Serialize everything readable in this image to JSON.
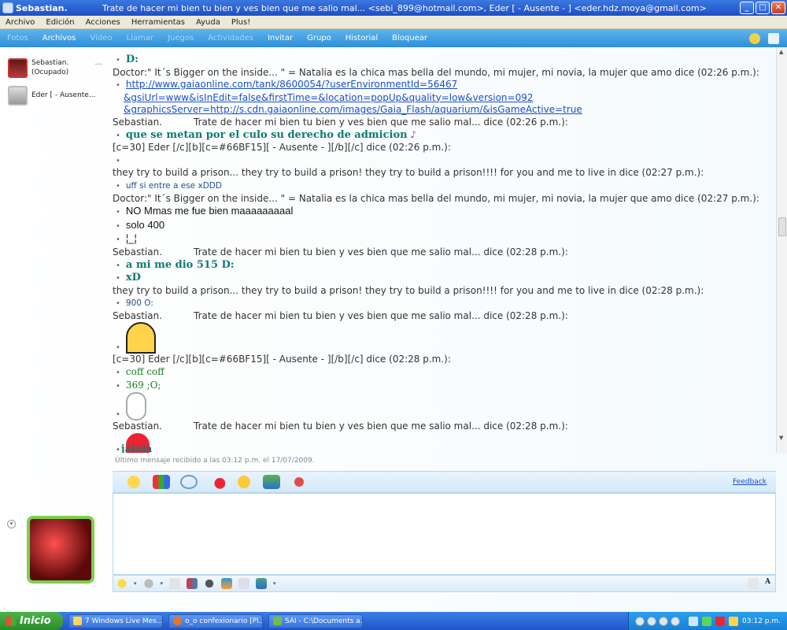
{
  "window": {
    "app_name": "Sebastian.",
    "title": "Trate de hacer mi bien tu bien y ves bien que me salio mal... <sebi_899@hotmail.com>,   Eder [ -  Ausente  -   ] <eder.hdz.moya@gmail.com>",
    "minimize": "_",
    "maximize": "□",
    "close": "✕"
  },
  "menu": [
    "Archivo",
    "Edición",
    "Acciones",
    "Herramientas",
    "Ayuda",
    "Plus!"
  ],
  "toolbar": {
    "items": [
      {
        "label": "Fotos",
        "enabled": false
      },
      {
        "label": "Archivos",
        "enabled": true
      },
      {
        "label": "Vídeo",
        "enabled": false
      },
      {
        "label": "Llamar",
        "enabled": false
      },
      {
        "label": "Juegos",
        "enabled": false
      },
      {
        "label": "Actividades",
        "enabled": false
      },
      {
        "label": "Invitar",
        "enabled": true
      },
      {
        "label": "Grupo",
        "enabled": true
      },
      {
        "label": "Historial",
        "enabled": true
      },
      {
        "label": "Bloquear",
        "enabled": true
      }
    ]
  },
  "contacts": [
    {
      "name": "Sebastian.",
      "status": "(Ocupado)",
      "more": "..."
    },
    {
      "name": "Eder [ -  Ausente...",
      "status": ""
    }
  ],
  "chat": {
    "lines": [
      {
        "type": "bullet",
        "style": "teal",
        "text": "D:"
      },
      {
        "type": "header",
        "text": "Doctor:\"  It´s Bigger on the inside... \" = Natalia es la chica mas bella del mundo, mi mujer, mi novia, la mujer que amo dice (02:26 p.m.):"
      },
      {
        "type": "bullet",
        "style": "link",
        "text": "http://www.gaiaonline.com/tank/8600054/?userEnvironmentId=56467"
      },
      {
        "type": "cont",
        "style": "link",
        "text": "&gsiUrl=www&isInEdit=false&firstTime=&location=popUp&quality=low&version=092"
      },
      {
        "type": "cont",
        "style": "link",
        "text": "&graphicsServer=http://s.cdn.gaiaonline.com/images/Gaia_Flash/aquarium/&isGameActive=true"
      },
      {
        "type": "header-seb",
        "who": "Sebastian.",
        "text": "Trate de hacer mi bien tu bien y ves bien que me salio mal... dice (02:26 p.m.):"
      },
      {
        "type": "bullet",
        "style": "teal",
        "text": "que se metan por el culo su derecho de admicion",
        "note": true
      },
      {
        "type": "header",
        "text": "[c=30]  Eder [/c][b][c=#66BF15][ -  Ausente  -    ][/b][/c] dice (02:26 p.m.):"
      },
      {
        "type": "bullet",
        "style": "blue",
        "text": ""
      },
      {
        "type": "header",
        "text": "they try to build a prison... they try to build a prison! they try to build a prison!!!! for you and me to live in dice (02:27 p.m.):"
      },
      {
        "type": "bullet",
        "style": "blue",
        "text": "uff si entre a ese xDDD"
      },
      {
        "type": "header",
        "text": "Doctor:\"  It´s Bigger on the inside... \" = Natalia es la chica mas bella del mundo, mi mujer, mi novia, la mujer que amo dice (02:27 p.m.):"
      },
      {
        "type": "bullet",
        "style": "black",
        "text": "NO Mmas me fue bien maaaaaaaaal"
      },
      {
        "type": "bullet",
        "style": "black",
        "text": "solo 400"
      },
      {
        "type": "bullet",
        "style": "black",
        "text": "¦_¦"
      },
      {
        "type": "header-seb",
        "who": "Sebastian.",
        "text": "Trate de hacer mi bien tu bien y ves bien que me salio mal... dice (02:28 p.m.):"
      },
      {
        "type": "bullet",
        "style": "teal",
        "text": "a mi me dio 515 D:"
      },
      {
        "type": "bullet",
        "style": "teal",
        "text": "xD"
      },
      {
        "type": "header",
        "text": "they try to build a prison... they try to build a prison! they try to build a prison!!!! for you and me to live in dice (02:28 p.m.):"
      },
      {
        "type": "bullet",
        "style": "blue",
        "text": "900 O:"
      },
      {
        "type": "header-seb",
        "who": "Sebastian.",
        "text": "Trate de hacer mi bien tu bien y ves bien que me salio mal... dice (02:28 p.m.):"
      },
      {
        "type": "emote",
        "kind": "yellow"
      },
      {
        "type": "header",
        "text": "[c=30]  Eder [/c][b][c=#66BF15][ -  Ausente  -    ][/b][/c] dice (02:28 p.m.):"
      },
      {
        "type": "bullet",
        "style": "green",
        "text": "coff coff"
      },
      {
        "type": "bullet",
        "style": "green",
        "text": "369 ;O;"
      },
      {
        "type": "emote",
        "kind": "ghost"
      },
      {
        "type": "header-seb",
        "who": "Sebastian.",
        "text": "Trate de hacer mi bien tu bien y ves bien que me salio mal... dice (02:28 p.m.):"
      },
      {
        "type": "emote",
        "kind": "fox",
        "text": "jajaja"
      }
    ],
    "last_message": "Último mensaje recibido a las 03:12 p.m. el 17/07/2009."
  },
  "emoticon_bar": {
    "feedback": "Feedback"
  },
  "taskbar": {
    "start": "Inicio",
    "tasks": [
      "7 Windows Live Mes...",
      "o_o confexionario [Pl...",
      "SAI - C:\\Documents a..."
    ],
    "clock": "03:12 p.m."
  },
  "colors": {
    "teal": "#0d7b73",
    "link": "#1a4fc7",
    "green": "#1c7a28",
    "taskbar": "#245edb"
  }
}
